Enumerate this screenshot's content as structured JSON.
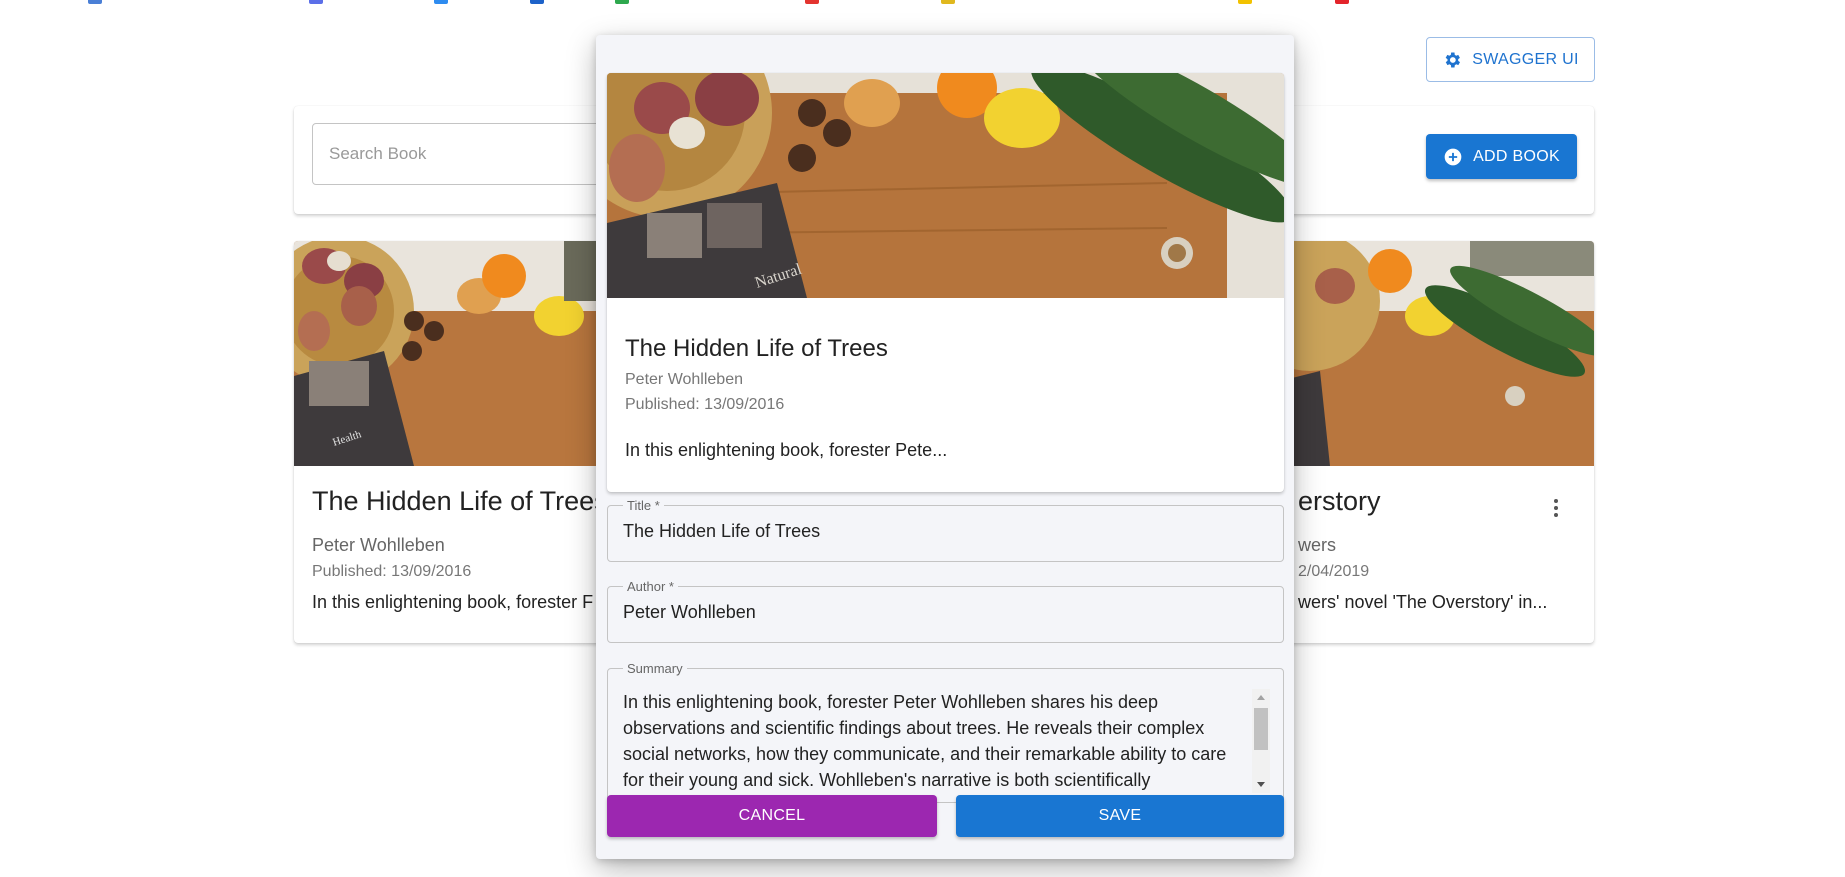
{
  "header": {
    "swagger_label": "SWAGGER UI"
  },
  "search": {
    "placeholder": "Search Book",
    "add_label": "ADD BOOK"
  },
  "cards": [
    {
      "title": "The Hidden Life of Trees",
      "author": "Peter Wohlleben",
      "published": "Published: 13/09/2016",
      "summary": "In this enlightening book, forester F"
    },
    {
      "title": "erstory",
      "author": "wers",
      "published": "2/04/2019",
      "summary": "wers' novel 'The Overstory' in..."
    }
  ],
  "dialog": {
    "preview": {
      "title": "The Hidden Life of Trees",
      "author": "Peter Wohlleben",
      "published": "Published: 13/09/2016",
      "summary": "In this enlightening book, forester Pete..."
    },
    "title_label": "Title *",
    "title_value": "The Hidden Life of Trees",
    "author_label": "Author *",
    "author_value": "Peter Wohlleben",
    "summary_label": "Summary",
    "summary_value": "In this enlightening book, forester Peter Wohlleben shares his deep observations and scientific findings about trees. He reveals their complex social networks, how they communicate, and their remarkable ability to care for their young and sick. Wohlleben's narrative is both scientifically",
    "cancel_label": "CANCEL",
    "save_label": "SAVE"
  },
  "colors": {
    "primary": "#1976d2",
    "secondary": "#9c27b0"
  }
}
